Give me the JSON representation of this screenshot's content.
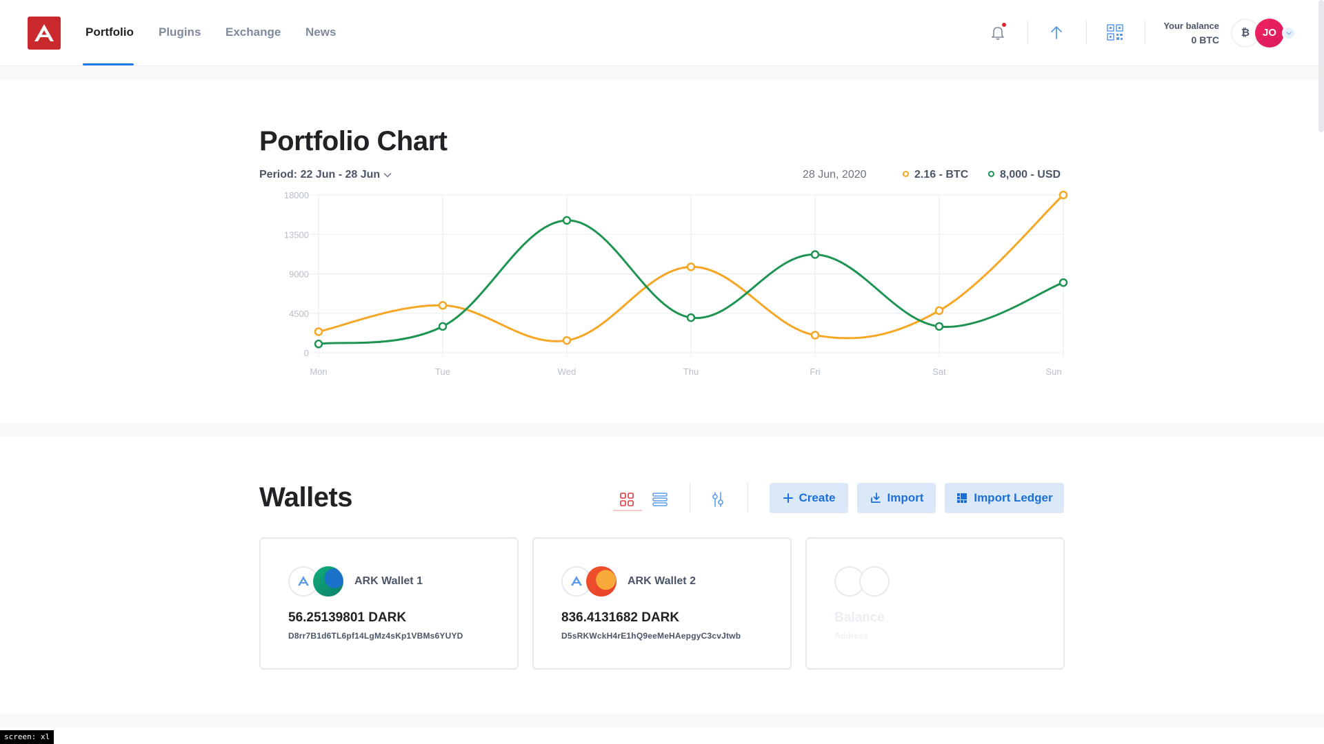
{
  "header": {
    "nav": [
      {
        "label": "Portfolio",
        "active": true
      },
      {
        "label": "Plugins",
        "active": false
      },
      {
        "label": "Exchange",
        "active": false
      },
      {
        "label": "News",
        "active": false
      }
    ],
    "balance_label": "Your balance",
    "balance_value": "0 BTC",
    "currency_symbol": "₿",
    "avatar_initials": "JO",
    "icons": [
      "bell-icon",
      "send-arrow-icon",
      "qr-code-icon"
    ],
    "brand_color": "#c9292c",
    "accent_color": "#1a79e8"
  },
  "portfolio": {
    "title": "Portfolio Chart",
    "period": "Period: 22 Jun - 28 Jun",
    "date": "28 Jun, 2020",
    "legend": [
      {
        "label": "2.16 - BTC",
        "color": "#f5a623"
      },
      {
        "label": "8,000 - USD",
        "color": "#1e9452"
      }
    ]
  },
  "chart_data": {
    "type": "line",
    "categories": [
      "Mon",
      "Tue",
      "Wed",
      "Thu",
      "Fri",
      "Sat",
      "Sun"
    ],
    "y_ticks": [
      0,
      4500,
      9000,
      13500,
      18000
    ],
    "ylim": [
      0,
      18000
    ],
    "grid": true,
    "series": [
      {
        "name": "2.16 - BTC",
        "color": "#f5a623",
        "values": [
          2400,
          5400,
          1400,
          9800,
          2000,
          4800,
          18000
        ]
      },
      {
        "name": "8,000 - USD",
        "color": "#1e9452",
        "values": [
          1000,
          3000,
          15100,
          4000,
          11200,
          3000,
          8000
        ]
      }
    ]
  },
  "wallets": {
    "title": "Wallets",
    "buttons": {
      "create": "Create",
      "import": "Import",
      "import_ledger": "Import Ledger"
    },
    "cards": [
      {
        "name": "ARK Wallet 1",
        "balance": "56.25139801 DARK",
        "address": "D8rr7B1d6TL6pf14LgMz4sKp1VBMs6YUYD",
        "avatar_colors": [
          "#0a8f6c",
          "#1a73c8"
        ]
      },
      {
        "name": "ARK Wallet 2",
        "balance": "836.4131682 DARK",
        "address": "D5sRKWckH4rE1hQ9eeMeHAepgyC3cvJtwb",
        "avatar_colors": [
          "#f0532d",
          "#f7a93a"
        ]
      },
      {
        "name": "",
        "balance": "Balance",
        "address": "Address",
        "placeholder": true
      }
    ]
  },
  "screen_tag": "screen: xl"
}
